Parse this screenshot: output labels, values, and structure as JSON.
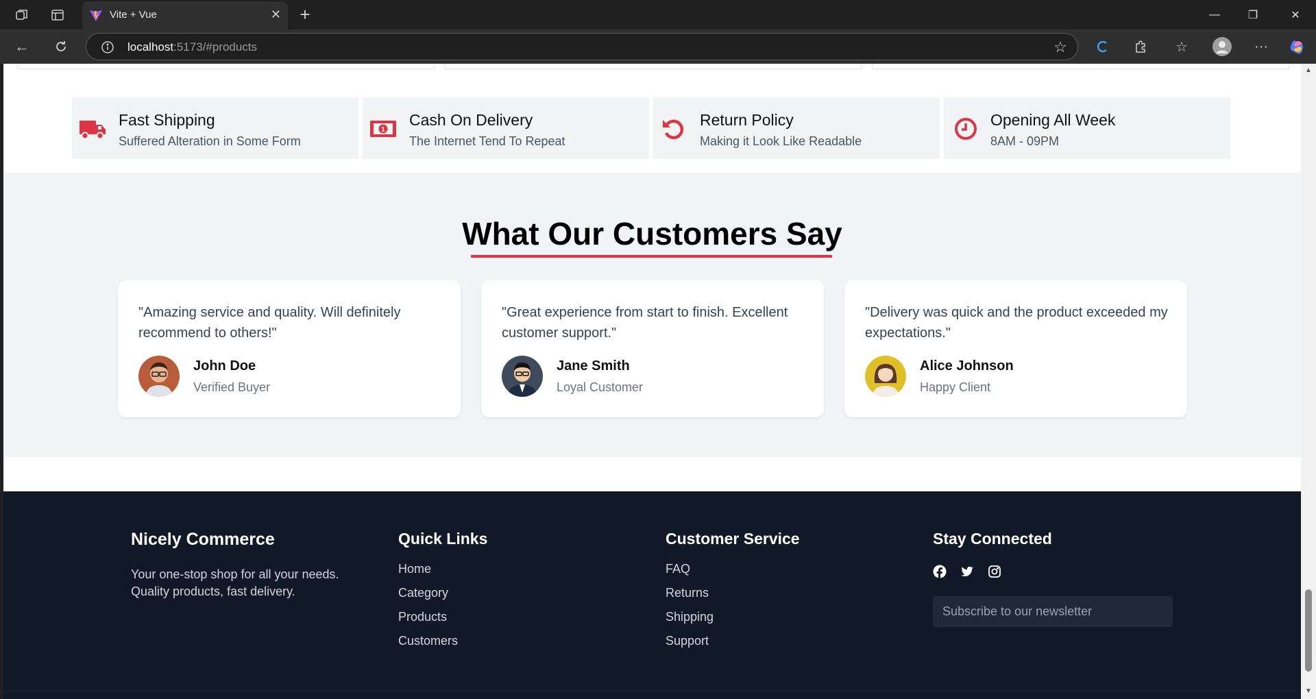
{
  "browser": {
    "tab_title": "Vite + Vue",
    "url_host": "localhost",
    "url_path": ":5173/#products"
  },
  "features": [
    {
      "icon": "truck-icon",
      "title": "Fast Shipping",
      "subtitle": "Suffered Alteration in Some Form"
    },
    {
      "icon": "money-icon",
      "title": "Cash On Delivery",
      "subtitle": "The Internet Tend To Repeat"
    },
    {
      "icon": "undo-icon",
      "title": "Return Policy",
      "subtitle": "Making it Look Like Readable"
    },
    {
      "icon": "clock-icon",
      "title": "Opening All Week",
      "subtitle": "8AM - 09PM"
    }
  ],
  "testimonials": {
    "heading": "What Our Customers Say",
    "items": [
      {
        "quote": "\"Amazing service and quality. Will definitely recommend to others!\"",
        "name": "John Doe",
        "role": "Verified Buyer"
      },
      {
        "quote": "\"Great experience from start to finish. Excellent customer support.\"",
        "name": "Jane Smith",
        "role": "Loyal Customer"
      },
      {
        "quote": "\"Delivery was quick and the product exceeded my expectations.\"",
        "name": "Alice Johnson",
        "role": "Happy Client"
      }
    ]
  },
  "footer": {
    "brand": "Nicely Commerce",
    "tagline": "Your one-stop shop for all your needs. Quality products, fast delivery.",
    "quick_links": {
      "heading": "Quick Links",
      "items": [
        "Home",
        "Category",
        "Products",
        "Customers"
      ]
    },
    "customer_service": {
      "heading": "Customer Service",
      "items": [
        "FAQ",
        "Returns",
        "Shipping",
        "Support"
      ]
    },
    "stay_connected": {
      "heading": "Stay Connected",
      "newsletter_placeholder": "Subscribe to our newsletter"
    }
  },
  "colors": {
    "accent": "#dc3545",
    "footer_bg": "#111827",
    "section_bg": "#f3f4f6"
  }
}
